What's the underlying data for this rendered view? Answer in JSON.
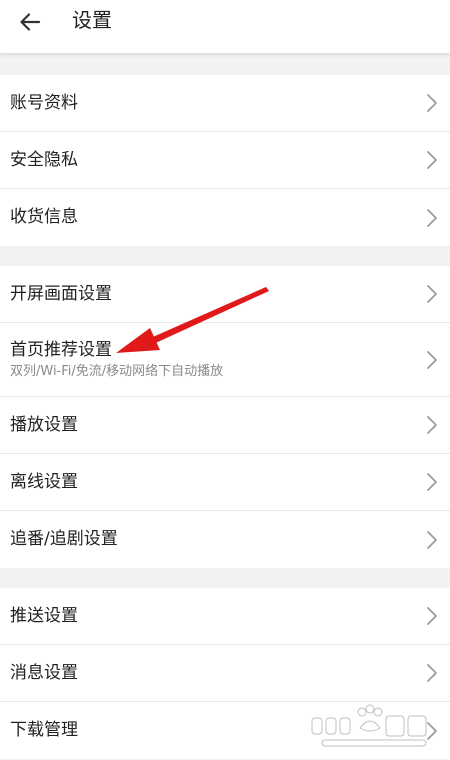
{
  "header": {
    "title": "设置",
    "back_icon": "back-arrow-icon"
  },
  "groups": [
    {
      "items": [
        {
          "label": "账号资料"
        },
        {
          "label": "安全隐私"
        },
        {
          "label": "收货信息"
        }
      ]
    },
    {
      "items": [
        {
          "label": "开屏画面设置"
        },
        {
          "label": "首页推荐设置",
          "sub": "双列/Wi-Fi/免流/移动网络下自动播放"
        },
        {
          "label": "播放设置"
        },
        {
          "label": "离线设置"
        },
        {
          "label": "追番/追剧设置"
        }
      ]
    },
    {
      "items": [
        {
          "label": "推送设置"
        },
        {
          "label": "消息设置"
        },
        {
          "label": "下载管理"
        }
      ]
    }
  ],
  "colors": {
    "background": "#f2f2f2",
    "row_bg": "#ffffff",
    "text": "#222222",
    "subtext": "#8a8a8a",
    "chevron": "#9b9b9b",
    "annotation_arrow": "#e0191b"
  },
  "watermark": {
    "logo_icon": "baidu-jingyan-logo-icon"
  }
}
